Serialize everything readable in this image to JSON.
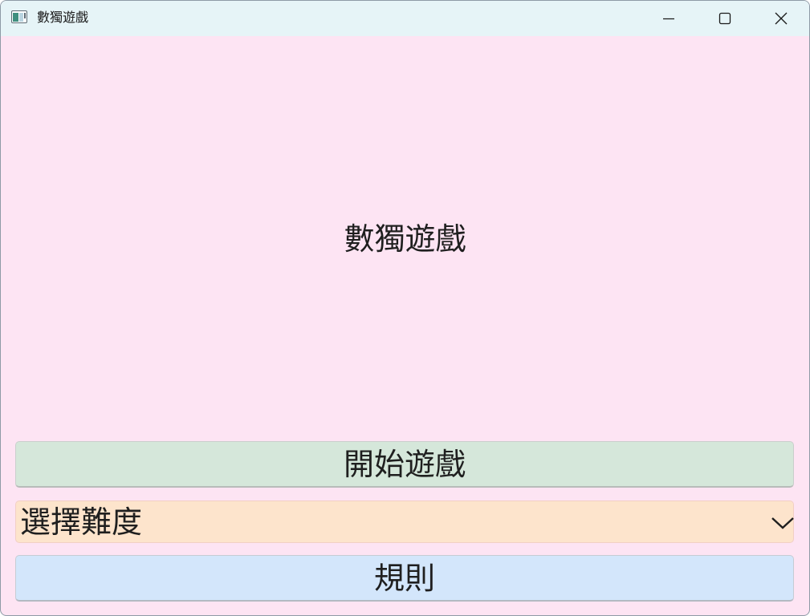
{
  "window": {
    "title": "數獨遊戲",
    "icon": "app-window-icon",
    "controls": [
      "minimize-icon",
      "maximize-icon",
      "close-icon"
    ]
  },
  "main": {
    "heading": "數獨遊戲",
    "start_button_label": "開始遊戲",
    "difficulty": {
      "selected_label": "選擇難度",
      "icon": "chevron-down-icon"
    },
    "rules_button_label": "規則"
  },
  "colors": {
    "background": "#fde4f3",
    "titlebar": "#e6f4f7",
    "start_button": "#d5e7da",
    "difficulty_select": "#fde4cc",
    "rules_button": "#d3e6fb"
  }
}
